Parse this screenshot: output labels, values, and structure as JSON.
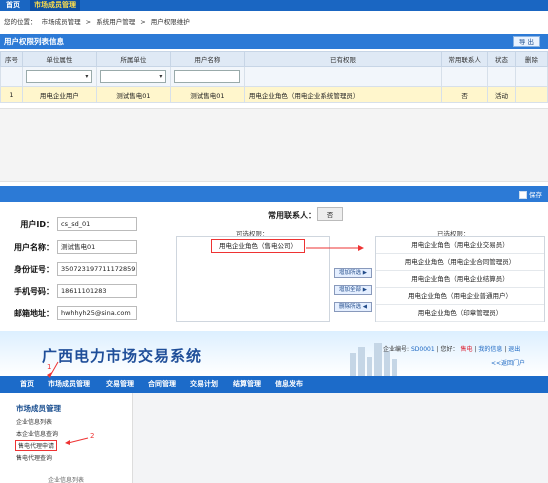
{
  "top_nav": {
    "home": "首页",
    "market_members": "市场成员管理"
  },
  "breadcrumb": {
    "prefix": "您的位置：",
    "l1": "市场成员管理",
    "sep": ">",
    "l2": "系统用户管理",
    "l3": "用户权限维护"
  },
  "list_panel": {
    "title": "用户权限列表信息",
    "export_label": "导 出",
    "columns": [
      "序号",
      "单位属性",
      "所属单位",
      "用户名称",
      "已有权限",
      "常用联系人",
      "状态",
      "删除"
    ],
    "filter_arrow": "▾",
    "rows": [
      {
        "no": "1",
        "unit_attr": "用电企业用户",
        "unit": "测试售电01",
        "user_name": "测试售电01",
        "permissions": "用电企业角色（用电企业系统管理员）",
        "contact": "否",
        "status": "活动",
        "delete": ""
      }
    ]
  },
  "form": {
    "save_label": "保存",
    "user_id_label": "用户ID：",
    "user_id": "cs_sd_01",
    "user_name_label": "用户名称：",
    "user_name": "测试售电01",
    "id_no_label": "身份证号：",
    "id_no": "350723197711172859",
    "phone_label": "手机号码：",
    "phone": "18611101283",
    "email_label": "邮箱地址：",
    "email": "hwhhyh25@sina.com",
    "contact_label": "常用联系人：",
    "contact_value": "否",
    "available_header": "可选权限：",
    "chosen_header": "已选权限：",
    "available": [
      "用电企业角色（售电公司）"
    ],
    "chosen": [
      "用电企业角色（用电企业交易员）",
      "用电企业角色（用电企业合同管理员）",
      "用电企业角色（用电企业结算员）",
      "用电企业角色（用电企业普通用户）",
      "用电企业角色（印章管理员）"
    ],
    "btn_add_selected": "增加所选 ▶",
    "btn_add_all": "增加全部 ▶",
    "btn_remove_selected": "删除所选 ◀"
  },
  "portal": {
    "title": "广西电力市场交易系统",
    "user_no_label": "企业编号:",
    "user_no": "SD0001",
    "greeting": "您好：",
    "user": "售电",
    "my_info": "我的信息",
    "logout": "退出",
    "back_portal": "<<返回门户",
    "nav": [
      "首页",
      "市场成员管理",
      "交易管理",
      "合同管理",
      "交易计划",
      "结算管理",
      "信息发布"
    ],
    "menu_title": "市场成员管理",
    "menu_items": [
      "企业信息列表",
      "本企业信息查询",
      "售电代理申请",
      "售电代理查询"
    ],
    "partial_menu": "企业信息列表",
    "marker1": "1",
    "marker2": "2"
  },
  "colors": {
    "header_blue": "#2c7ad6",
    "nav_blue": "#1c6bc9",
    "highlight_row": "#fff6cc",
    "annotation_red": "#e33"
  }
}
